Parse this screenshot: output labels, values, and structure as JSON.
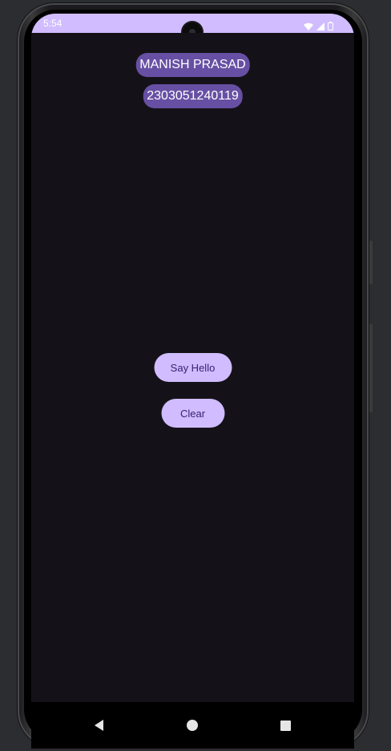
{
  "status_bar": {
    "time": "5:54",
    "icons": [
      "wifi-icon",
      "signal-icon",
      "battery-icon"
    ]
  },
  "app": {
    "name_label": "MANISH PRASAD",
    "id_label": "2303051240119",
    "say_hello_label": "Say Hello",
    "clear_label": "Clear"
  },
  "nav_bar": {
    "icons": [
      "back-icon",
      "home-icon",
      "recents-icon"
    ]
  },
  "colors": {
    "status_bar": "#d0bcff",
    "background": "#141218",
    "pill": "#6750a4",
    "button": "#d0bcff",
    "button_text": "#381e72"
  }
}
